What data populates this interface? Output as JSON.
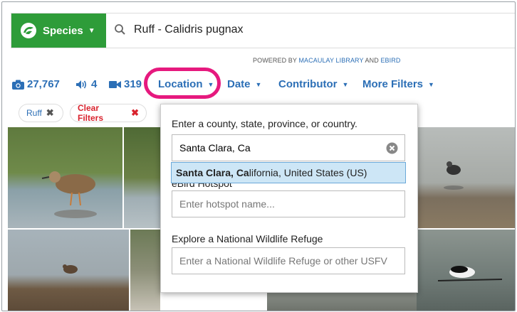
{
  "search": {
    "species_button_label": "Species",
    "query": "Ruff - Calidris pugnax"
  },
  "powered_by": {
    "prefix": "POWERED BY ",
    "macaulay": "MACAULAY LIBRARY",
    "and": " AND ",
    "ebird": "EBIRD"
  },
  "stats": {
    "photos": "27,767",
    "audio": "4",
    "video": "319"
  },
  "filters": {
    "location": "Location",
    "date": "Date",
    "contributor": "Contributor",
    "more": "More Filters"
  },
  "chips": {
    "ruff": "Ruff",
    "clear": "Clear Filters"
  },
  "location_popup": {
    "region_label": "Enter a county, state, province, or country.",
    "region_value": "Santa Clara, Ca",
    "suggestion_bold": "Santa Clara, Ca",
    "suggestion_rest": "lifornia, United States (US)",
    "hotspot_label": "eBird Hotspot",
    "hotspot_placeholder": "Enter hotspot name...",
    "refuge_label": "Explore a National Wildlife Refuge",
    "refuge_placeholder": "Enter a National Wildlife Refuge or other USFV"
  },
  "colors": {
    "brand_green": "#2e9c39",
    "link_blue": "#2c6fb6",
    "highlight_pink": "#e6197e",
    "clear_red": "#d9232e"
  }
}
